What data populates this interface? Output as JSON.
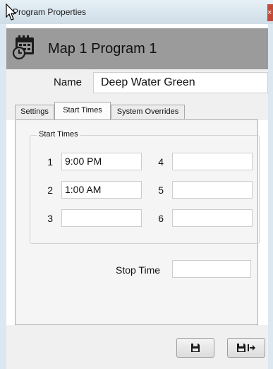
{
  "window": {
    "title": "Program Properties",
    "close_label": "×"
  },
  "header": {
    "title": "Map 1 Program 1",
    "icon": "calendar-clock-icon"
  },
  "name_field": {
    "label": "Name",
    "value": "Deep Water Green"
  },
  "tabs": [
    {
      "label": "Settings",
      "active": false
    },
    {
      "label": "Start Times",
      "active": true
    },
    {
      "label": "System Overrides",
      "active": false
    }
  ],
  "start_times": {
    "group_label": "Start Times",
    "slots": [
      {
        "number": "1",
        "value": "9:00 PM"
      },
      {
        "number": "2",
        "value": "1:00 AM"
      },
      {
        "number": "3",
        "value": ""
      },
      {
        "number": "4",
        "value": ""
      },
      {
        "number": "5",
        "value": ""
      },
      {
        "number": "6",
        "value": ""
      }
    ]
  },
  "stop_time": {
    "label": "Stop Time",
    "value": ""
  },
  "buttons": {
    "save_icon": "floppy-disk-icon",
    "save_close_icon": "floppy-disk-exit-icon"
  }
}
